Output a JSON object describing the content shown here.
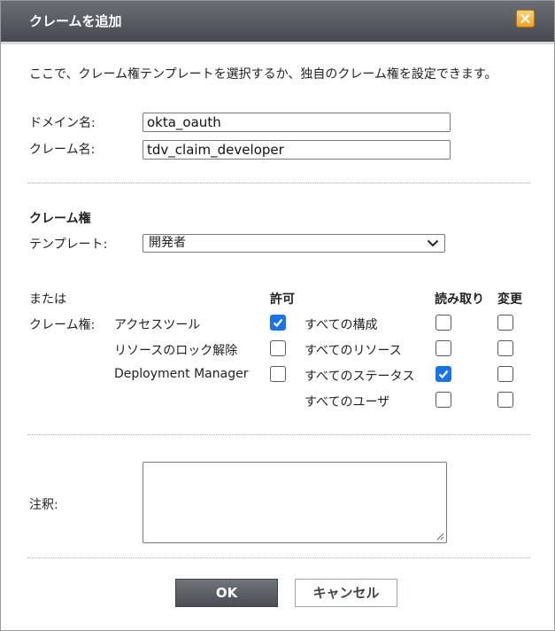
{
  "dialog": {
    "title": "クレームを追加",
    "intro": "ここで、クレーム権テンプレートを選択するか、独自のクレーム権を設定できます。"
  },
  "form": {
    "domain_label": "ドメイン名:",
    "domain_value": "okta_oauth",
    "claim_label": "クレーム名:",
    "claim_value": "tdv_claim_developer"
  },
  "claims": {
    "section_title": "クレーム権",
    "template_label": "テンプレート:",
    "template_selected": "開発者",
    "or_label": "または",
    "rights_label": "クレーム権:",
    "col_permit": "許可",
    "col_read": "読み取り",
    "col_modify": "変更",
    "permissions": [
      {
        "label": "アクセスツール",
        "checked": true
      },
      {
        "label": "リソースのロック解除",
        "checked": false
      },
      {
        "label": "Deployment Manager",
        "checked": false
      }
    ],
    "scopes": [
      {
        "label": "すべての構成",
        "read": false,
        "modify": false
      },
      {
        "label": "すべてのリソース",
        "read": false,
        "modify": false
      },
      {
        "label": "すべてのステータス",
        "read": true,
        "modify": false
      },
      {
        "label": "すべてのユーザ",
        "read": false,
        "modify": false
      }
    ]
  },
  "annotation": {
    "label": "注釈:",
    "value": ""
  },
  "buttons": {
    "ok": "OK",
    "cancel": "キャンセル"
  },
  "icons": {
    "close": "close-icon",
    "dropdown": "chevron-down-icon",
    "check": "checkmark-icon",
    "resize": "resize-grip-icon"
  },
  "colors": {
    "accent": "#1a73e8",
    "titlebar": "#55595f",
    "close": "#f0a21e"
  }
}
